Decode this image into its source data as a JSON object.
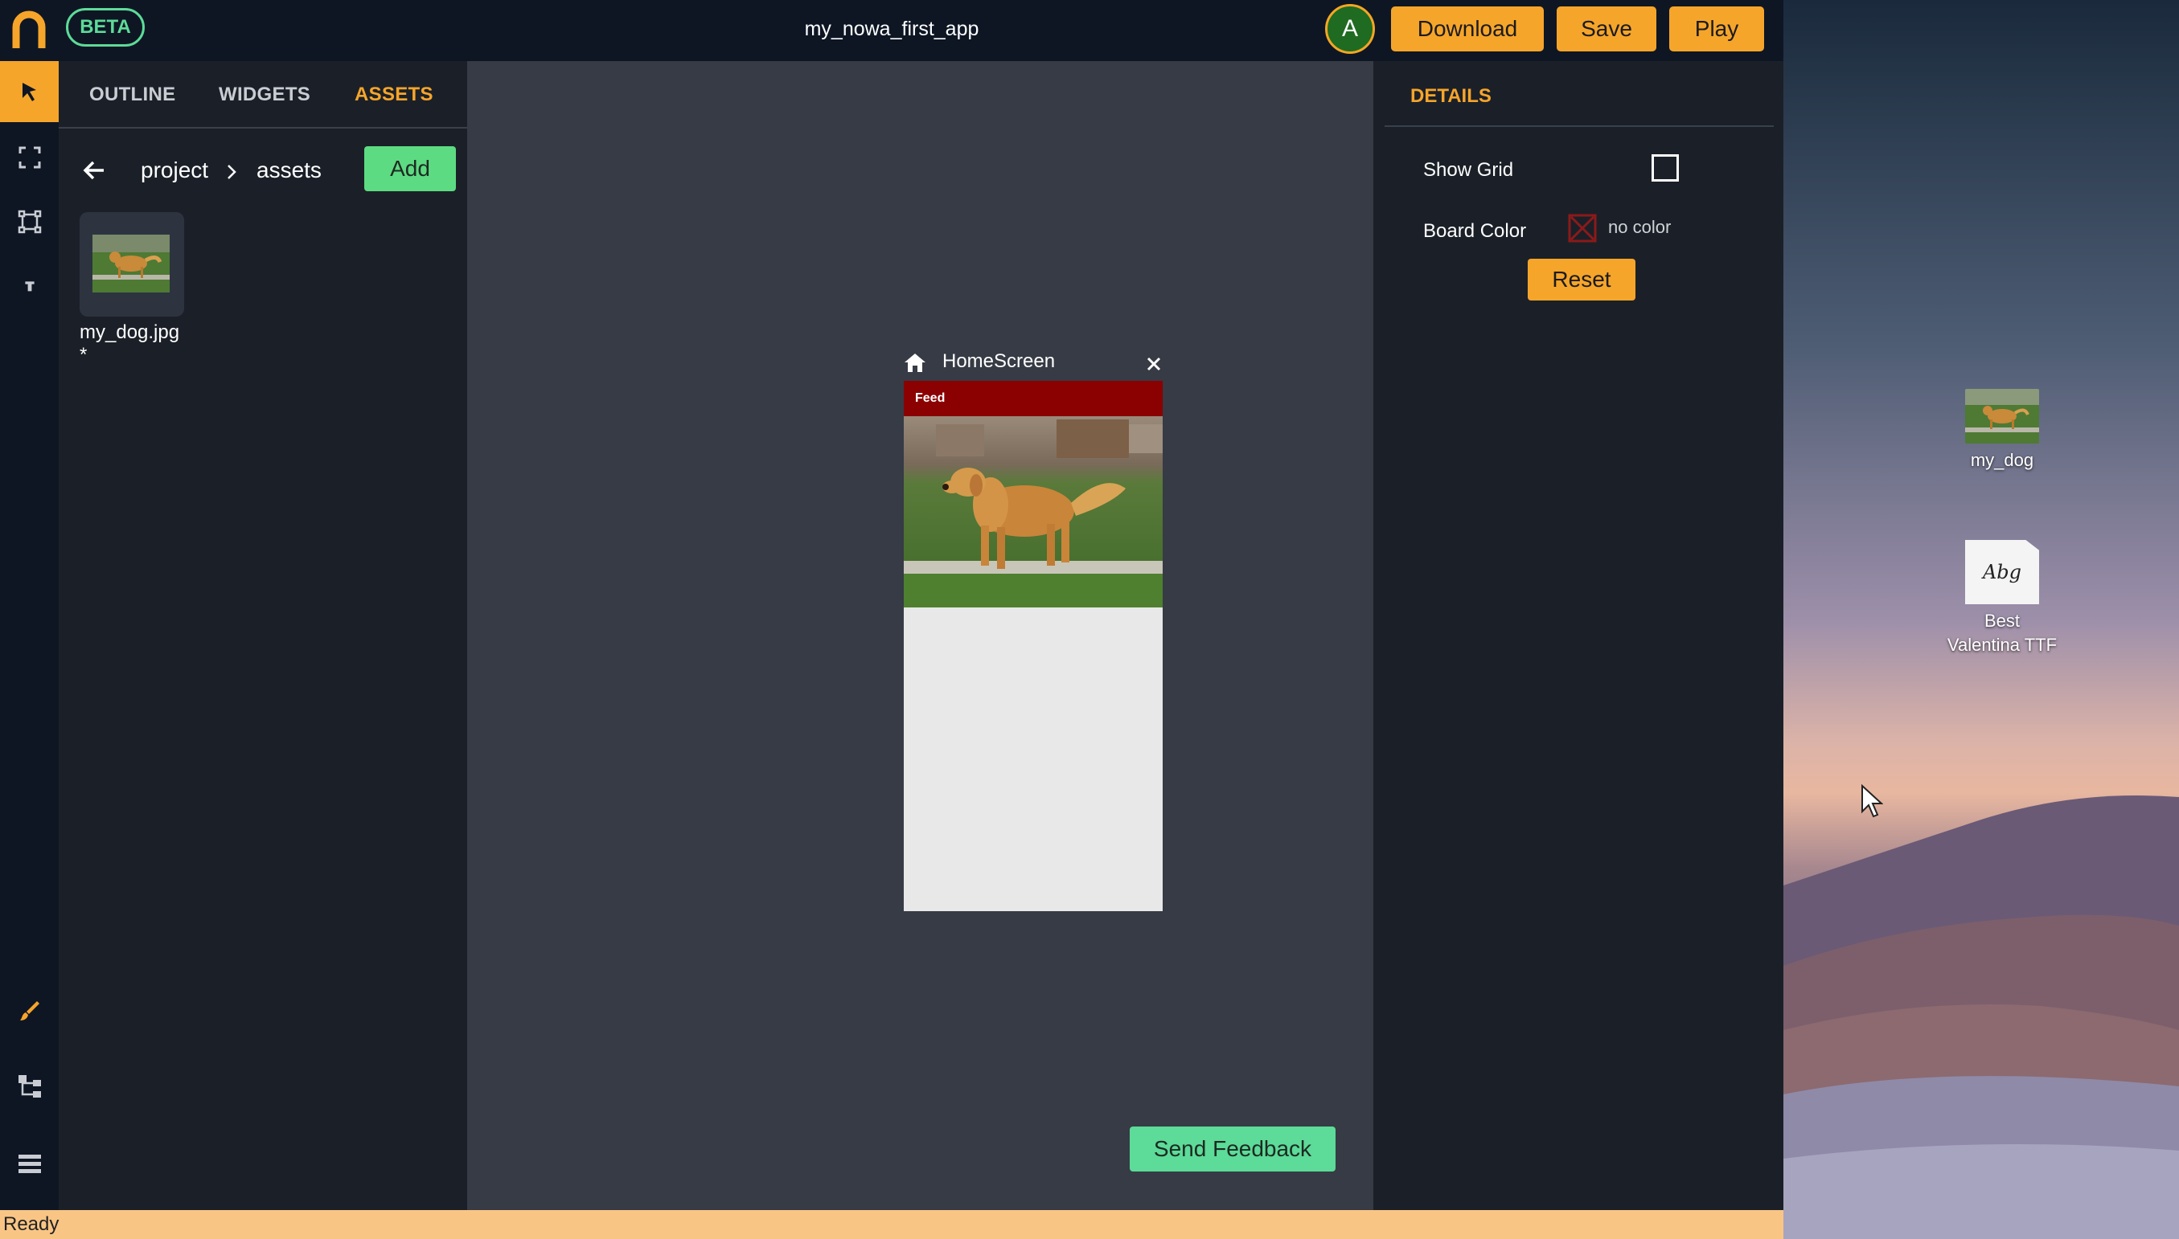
{
  "app": {
    "title": "my_nowa_first_app",
    "beta_label": "BETA",
    "avatar_letter": "A",
    "buttons": {
      "download": "Download",
      "save": "Save",
      "play": "Play"
    }
  },
  "left_panel": {
    "tabs": [
      {
        "label": "OUTLINE",
        "active": false
      },
      {
        "label": "WIDGETS",
        "active": false
      },
      {
        "label": "ASSETS",
        "active": true
      }
    ],
    "breadcrumb": [
      "project",
      "assets"
    ],
    "add_label": "Add",
    "assets": [
      {
        "name": "my_dog.jpg",
        "marker": "*"
      }
    ]
  },
  "tools": {
    "top": [
      "pointer-icon",
      "frame-icon",
      "rectangle-icon",
      "text-icon"
    ],
    "bottom": [
      "brush-icon",
      "tree-icon",
      "layers-icon"
    ]
  },
  "canvas": {
    "screen_title": "HomeScreen",
    "appbar_title": "Feed",
    "feedback_label": "Send Feedback"
  },
  "details": {
    "title": "DETAILS",
    "show_grid_label": "Show Grid",
    "show_grid_checked": false,
    "board_color_label": "Board Color",
    "board_color_value": "no color",
    "reset_label": "Reset"
  },
  "status": {
    "text": "Ready"
  },
  "desktop": {
    "icons": [
      {
        "label": "my_dog"
      },
      {
        "label_line1": "Best",
        "label_line2": "Valentina TTF",
        "glyph": "Abg"
      }
    ]
  },
  "colors": {
    "accent": "#f6a52b",
    "green": "#5ddb98",
    "appbar": "#8b0000",
    "topbar": "#0e1624"
  }
}
